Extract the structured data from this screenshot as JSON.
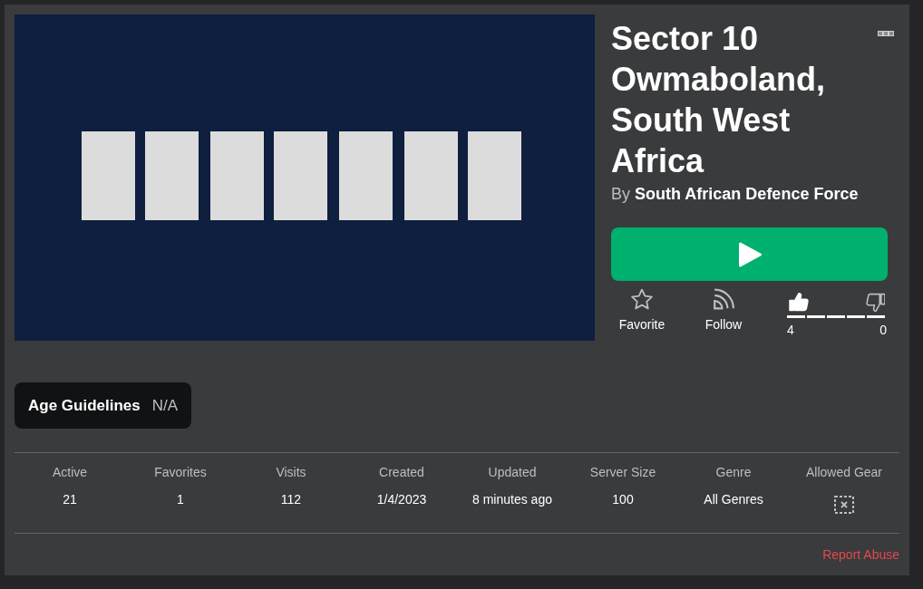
{
  "game": {
    "title": "Sector 10 Owmaboland, South West Africa",
    "by_label": "By",
    "creator": "South African Defence Force"
  },
  "actions": [
    {
      "kind": "favorite",
      "label": "Favorite",
      "selected": false
    },
    {
      "kind": "follow",
      "label": "Follow",
      "selected": false
    }
  ],
  "votes": {
    "level": 1,
    "buttons": [
      {
        "kind": "up",
        "count": "4",
        "selected": true
      },
      {
        "kind": "down",
        "count": "0",
        "selected": false
      }
    ]
  },
  "age_guidelines": {
    "label": "Age Guidelines",
    "value": "N/A"
  },
  "stats": [
    {
      "label": "Active",
      "kind": "text",
      "value": "21"
    },
    {
      "label": "Favorites",
      "kind": "text",
      "value": "1"
    },
    {
      "label": "Visits",
      "kind": "text",
      "value": "112"
    },
    {
      "label": "Created",
      "kind": "text",
      "value": "1/4/2023"
    },
    {
      "label": "Updated",
      "kind": "text",
      "value": "8 minutes ago"
    },
    {
      "label": "Server Size",
      "kind": "text",
      "value": "100"
    },
    {
      "label": "Genre",
      "kind": "text",
      "value": "All Genres"
    },
    {
      "label": "Allowed Gear",
      "kind": "no_gear"
    }
  ],
  "report_link": "Report Abuse"
}
